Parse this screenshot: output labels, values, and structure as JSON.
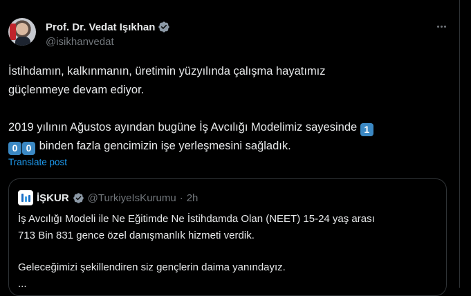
{
  "tweet": {
    "author": {
      "display_name": "Prof. Dr. Vedat Işıkhan",
      "handle": "@isikhanvedat"
    },
    "body": {
      "line1": "İstihdamın, kalkınmanın, üretimin yüzyılında çalışma hayatımız",
      "line2": "güçlenmeye devam ediyor.",
      "line3": "2019 yılının Ağustos ayından bugüne İş Avcılığı Modelimiz sayesinde",
      "keycap1": "1",
      "keycap2": "0",
      "keycap3": "0",
      "line4_rest": "binden fazla gencimizin işe yerleşmesini sağladık."
    },
    "translate_label": "Translate post",
    "icons": {
      "more": "more-dots-icon",
      "verified": "verified-badge-icon"
    },
    "colors": {
      "link": "#1d9bf0",
      "verified_blue": "#1d9bf0",
      "verified_gold": "#e2b719",
      "keycap": "#3b88c3"
    }
  },
  "quoted": {
    "display_name": "İŞKUR",
    "handle": "@TurkiyeIsKurumu",
    "separator": "·",
    "time": "2h",
    "body": {
      "line1": "İş Avcılığı Modeli ile Ne Eğitimde Ne İstihdamda Olan (NEET) 15-24 yaş arası",
      "line2": "713 Bin 831 gence özel danışmanlık hizmeti verdik.",
      "line3": "Geleceğimizi şekillendiren siz gençlerin daima yanındayız.",
      "line4": "..."
    }
  }
}
